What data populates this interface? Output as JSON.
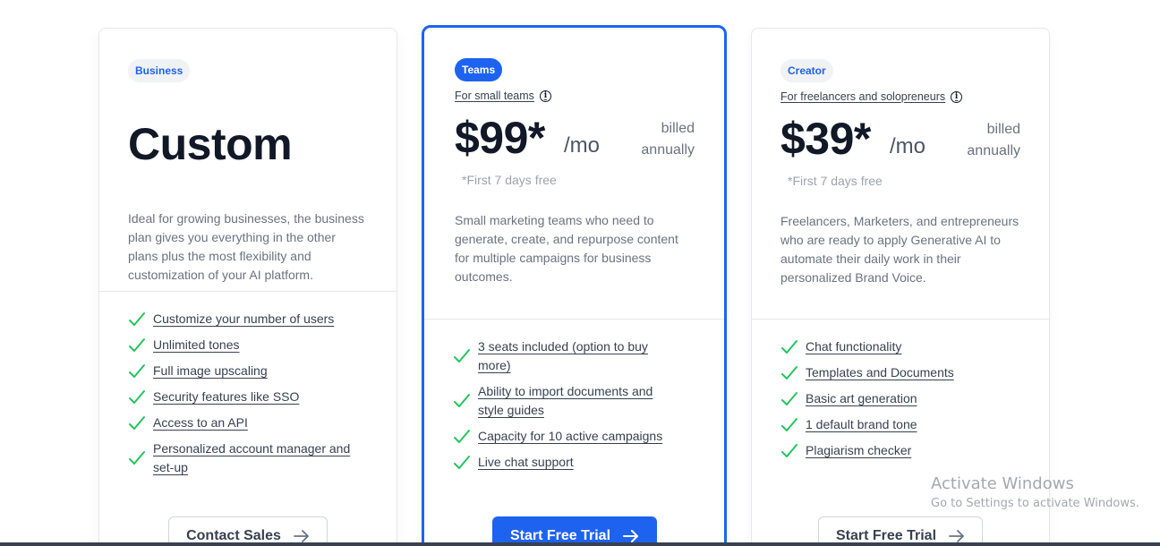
{
  "plans": {
    "business": {
      "badge": "Business",
      "title": "Custom",
      "description": "Ideal for growing businesses, the business plan gives you everything in the other plans plus the most flexibility and customization of your AI platform.",
      "features": [
        "Customize your number of users",
        "Unlimited tones",
        "Full image upscaling",
        "Security features like SSO",
        "Access to an API",
        "Personalized account manager and set-up"
      ],
      "cta": "Contact Sales"
    },
    "teams": {
      "badge": "Teams",
      "subtitle": "For small teams",
      "price": "$99*",
      "per": "/mo",
      "billed": "billed annually",
      "trial_note": "*First 7 days free",
      "description": "Small marketing teams who need to generate, create, and repurpose content for multiple campaigns for business outcomes.",
      "features": [
        "3 seats included (option to buy more)",
        "Ability to import documents and style guides",
        "Capacity for 10 active campaigns",
        "Live chat support"
      ],
      "cta": "Start Free Trial"
    },
    "creator": {
      "badge": "Creator",
      "subtitle": "For freelancers and solopreneurs",
      "price": "$39*",
      "per": "/mo",
      "billed": "billed annually",
      "trial_note": "*First 7 days free",
      "description": "Freelancers, Marketers, and entrepreneurs who are ready to apply Generative AI to automate their daily work in their personalized Brand Voice.",
      "features": [
        "Chat functionality",
        "Templates and Documents",
        "Basic art generation",
        "1 default brand tone",
        "Plagiarism checker"
      ],
      "cta": "Start Free Trial"
    }
  },
  "watermark": {
    "title": "Activate Windows",
    "subtitle": "Go to Settings to activate Windows."
  },
  "icons": {
    "check": "check-icon",
    "arrow": "arrow-right-icon",
    "info": "info-icon"
  },
  "colors": {
    "accent": "#1e63f0",
    "check": "#22c55e",
    "text": "#111827",
    "muted": "#6b7280"
  }
}
